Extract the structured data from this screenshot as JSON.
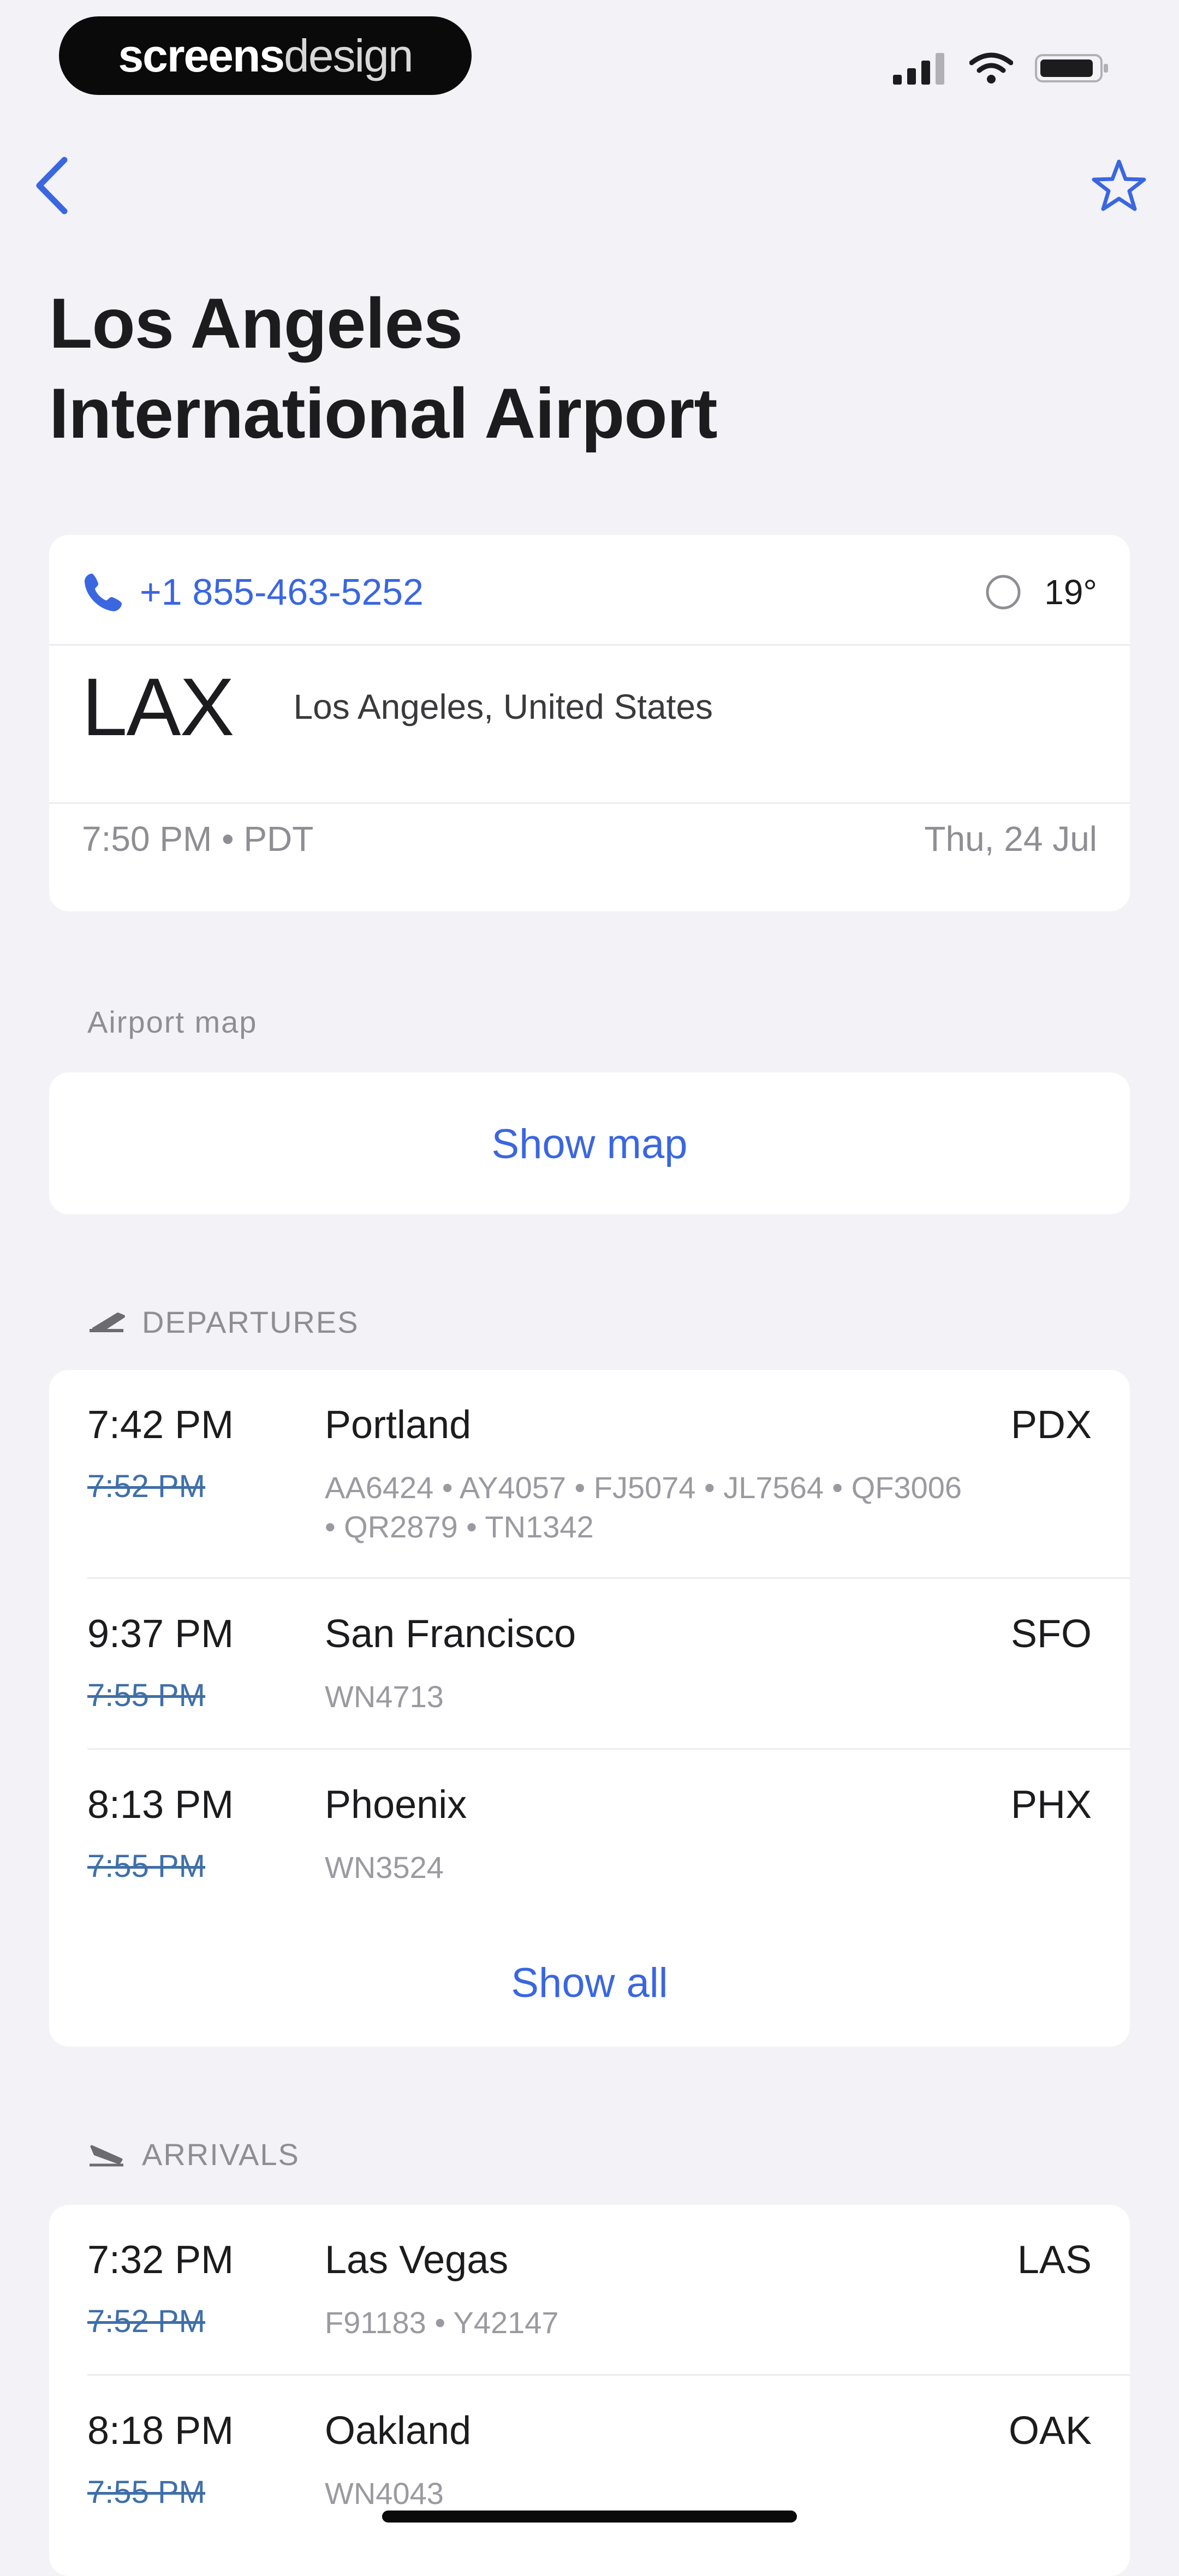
{
  "status_bar": {
    "brand_bold": "screens",
    "brand_light": "design"
  },
  "nav": {
    "back_icon": "chevron-left-icon",
    "favorite_icon": "star-icon"
  },
  "airport": {
    "name_line1": "Los Angeles",
    "name_line2": "International Airport",
    "phone": "+1 855-463-5252",
    "temperature": "19°",
    "code": "LAX",
    "location": "Los Angeles, United States",
    "local_time": "7:50 PM • PDT",
    "local_date": "Thu, 24 Jul"
  },
  "airport_map": {
    "label": "Airport map",
    "button": "Show map"
  },
  "departures": {
    "label": "DEPARTURES",
    "rows": [
      {
        "time": "7:42 PM",
        "scheduled": "7:52 PM",
        "city": "Portland",
        "code": "PDX",
        "flights": "AA6424 • AY4057 • FJ5074 • JL7564 • QF3006 • QR2879 • TN1342"
      },
      {
        "time": "9:37 PM",
        "scheduled": "7:55 PM",
        "city": "San Francisco",
        "code": "SFO",
        "flights": "WN4713"
      },
      {
        "time": "8:13 PM",
        "scheduled": "7:55 PM",
        "city": "Phoenix",
        "code": "PHX",
        "flights": "WN3524"
      }
    ],
    "show_all": "Show all"
  },
  "arrivals": {
    "label": "ARRIVALS",
    "rows": [
      {
        "time": "7:32 PM",
        "scheduled": "7:52 PM",
        "city": "Las Vegas",
        "code": "LAS",
        "flights": "F91183 • Y42147"
      },
      {
        "time": "8:18 PM",
        "scheduled": "7:55 PM",
        "city": "Oakland",
        "code": "OAK",
        "flights": "WN4043"
      }
    ]
  },
  "colors": {
    "accent": "#3a66e0",
    "background": "#f2f2f7",
    "card": "#ffffff"
  }
}
